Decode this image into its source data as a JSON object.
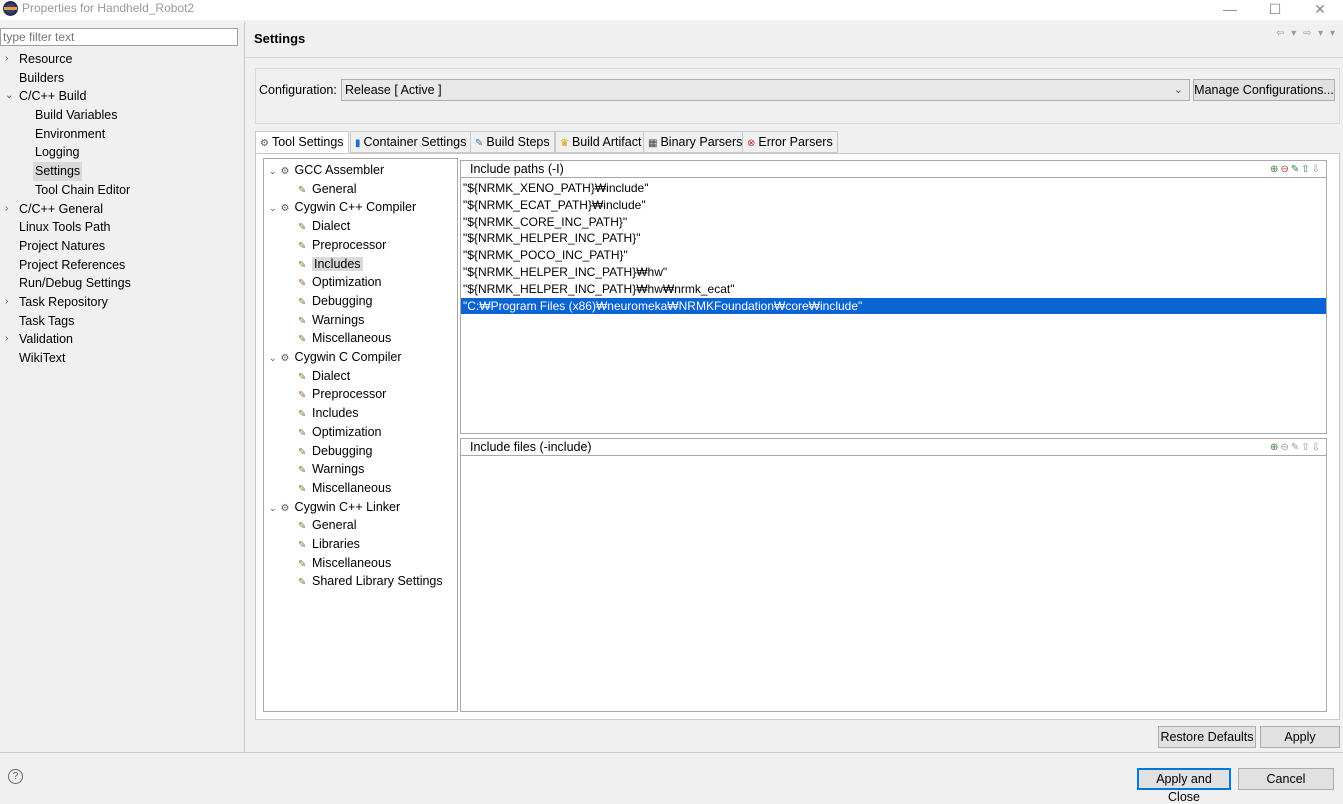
{
  "window": {
    "title": "Properties for Handheld_Robot2",
    "minimize": "—",
    "maximize": "☐",
    "close": "✕"
  },
  "filter": {
    "placeholder": "type filter text"
  },
  "left_tree": [
    {
      "label": "Resource",
      "indent": 0,
      "twisty": "›"
    },
    {
      "label": "Builders",
      "indent": 0,
      "twisty": ""
    },
    {
      "label": "C/C++ Build",
      "indent": 0,
      "twisty": "⌄"
    },
    {
      "label": "Build Variables",
      "indent": 1,
      "twisty": ""
    },
    {
      "label": "Environment",
      "indent": 1,
      "twisty": ""
    },
    {
      "label": "Logging",
      "indent": 1,
      "twisty": ""
    },
    {
      "label": "Settings",
      "indent": 1,
      "twisty": "",
      "selected": true
    },
    {
      "label": "Tool Chain Editor",
      "indent": 1,
      "twisty": ""
    },
    {
      "label": "C/C++ General",
      "indent": 0,
      "twisty": "›"
    },
    {
      "label": "Linux Tools Path",
      "indent": 0,
      "twisty": ""
    },
    {
      "label": "Project Natures",
      "indent": 0,
      "twisty": ""
    },
    {
      "label": "Project References",
      "indent": 0,
      "twisty": ""
    },
    {
      "label": "Run/Debug Settings",
      "indent": 0,
      "twisty": ""
    },
    {
      "label": "Task Repository",
      "indent": 0,
      "twisty": "›"
    },
    {
      "label": "Task Tags",
      "indent": 0,
      "twisty": ""
    },
    {
      "label": "Validation",
      "indent": 0,
      "twisty": "›"
    },
    {
      "label": "WikiText",
      "indent": 0,
      "twisty": ""
    }
  ],
  "page": {
    "title": "Settings",
    "nav": "⇦ ▾ ⇨ ▾ ▾"
  },
  "configuration": {
    "label": "Configuration:",
    "value": "Release  [ Active ]",
    "manage_label": "Manage Configurations..."
  },
  "tabs": [
    {
      "label": "Tool Settings",
      "icon": "⚙",
      "active": true
    },
    {
      "label": "Container Settings",
      "icon": "▮"
    },
    {
      "label": "Build Steps",
      "icon": "✎"
    },
    {
      "label": "Build Artifact",
      "icon": "♛"
    },
    {
      "label": "Binary Parsers",
      "icon": "▦"
    },
    {
      "label": "Error Parsers",
      "icon": "⊗"
    }
  ],
  "tool_tree": [
    {
      "label": "GCC Assembler",
      "cat": true
    },
    {
      "label": "General"
    },
    {
      "label": "Cygwin C++ Compiler",
      "cat": true
    },
    {
      "label": "Dialect"
    },
    {
      "label": "Preprocessor"
    },
    {
      "label": "Includes",
      "selected": true
    },
    {
      "label": "Optimization"
    },
    {
      "label": "Debugging"
    },
    {
      "label": "Warnings"
    },
    {
      "label": "Miscellaneous"
    },
    {
      "label": "Cygwin C Compiler",
      "cat": true
    },
    {
      "label": "Dialect"
    },
    {
      "label": "Preprocessor"
    },
    {
      "label": "Includes"
    },
    {
      "label": "Optimization"
    },
    {
      "label": "Debugging"
    },
    {
      "label": "Warnings"
    },
    {
      "label": "Miscellaneous"
    },
    {
      "label": "Cygwin C++ Linker",
      "cat": true
    },
    {
      "label": "General"
    },
    {
      "label": "Libraries"
    },
    {
      "label": "Miscellaneous"
    },
    {
      "label": "Shared Library Settings"
    }
  ],
  "include_paths": {
    "title": "Include paths (-I)",
    "items": [
      "\"${NRMK_XENO_PATH}₩include\"",
      "\"${NRMK_ECAT_PATH}₩include\"",
      "\"${NRMK_CORE_INC_PATH}\"",
      "\"${NRMK_HELPER_INC_PATH}\"",
      "\"${NRMK_POCO_INC_PATH}\"",
      "\"${NRMK_HELPER_INC_PATH}₩hw\"",
      "\"${NRMK_HELPER_INC_PATH}₩hw₩nrmk_ecat\"",
      "\"C:₩Program Files (x86)₩neuromeka₩NRMKFoundation₩core₩include\""
    ],
    "selected_index": 7
  },
  "include_files": {
    "title": "Include files (-include)",
    "items": []
  },
  "buttons": {
    "restore_defaults": "Restore Defaults",
    "apply": "Apply",
    "apply_and_close": "Apply and Close",
    "cancel": "Cancel"
  },
  "help": "?"
}
